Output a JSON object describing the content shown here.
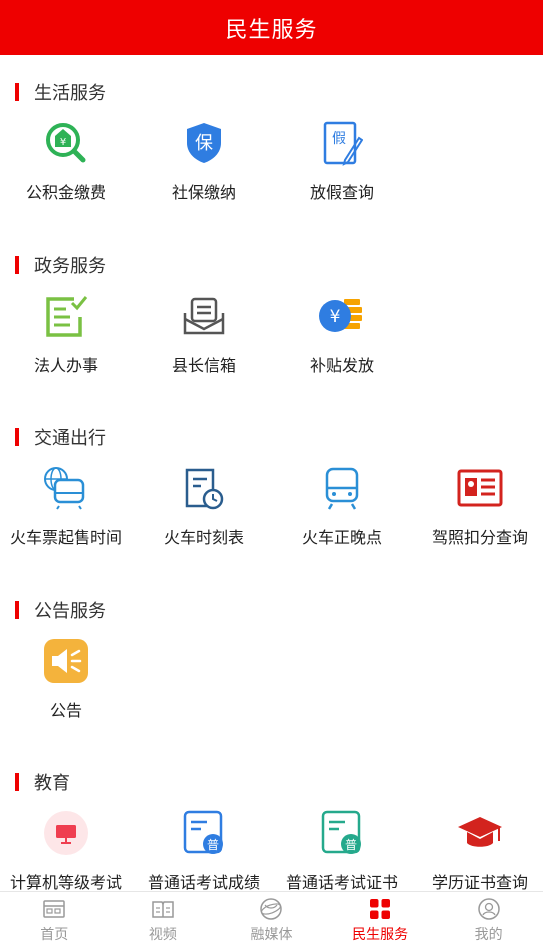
{
  "header": {
    "title": "民生服务"
  },
  "sections": [
    {
      "title": "生活服务",
      "items": [
        {
          "label": "公积金缴费",
          "icon": "housing-fund-icon"
        },
        {
          "label": "社保缴纳",
          "icon": "social-security-shield-icon"
        },
        {
          "label": "放假查询",
          "icon": "holiday-document-icon"
        }
      ]
    },
    {
      "title": "政务服务",
      "items": [
        {
          "label": "法人办事",
          "icon": "checklist-icon"
        },
        {
          "label": "县长信箱",
          "icon": "mailbox-icon"
        },
        {
          "label": "补贴发放",
          "icon": "subsidy-coin-icon"
        }
      ]
    },
    {
      "title": "交通出行",
      "items": [
        {
          "label": "火车票起售时间",
          "icon": "train-globe-icon"
        },
        {
          "label": "火车时刻表",
          "icon": "timetable-clock-icon"
        },
        {
          "label": "火车正晚点",
          "icon": "train-icon"
        },
        {
          "label": "驾照扣分查询",
          "icon": "driver-license-icon"
        }
      ]
    },
    {
      "title": "公告服务",
      "items": [
        {
          "label": "公告",
          "icon": "speaker-icon"
        }
      ]
    },
    {
      "title": "教育",
      "items": [
        {
          "label": "计算机等级考试",
          "icon": "computer-icon"
        },
        {
          "label": "普通话考试成绩",
          "icon": "mandarin-score-icon"
        },
        {
          "label": "普通话考试证书",
          "icon": "mandarin-certificate-icon"
        },
        {
          "label": "学历证书查询",
          "icon": "graduation-cap-icon"
        }
      ]
    }
  ],
  "tabs": [
    {
      "label": "首页",
      "icon": "home-icon"
    },
    {
      "label": "视频",
      "icon": "video-icon"
    },
    {
      "label": "融媒体",
      "icon": "media-icon"
    },
    {
      "label": "民生服务",
      "icon": "services-grid-icon",
      "active": true
    },
    {
      "label": "我的",
      "icon": "profile-icon"
    }
  ],
  "colors": {
    "brand_red": "#ee0000"
  }
}
